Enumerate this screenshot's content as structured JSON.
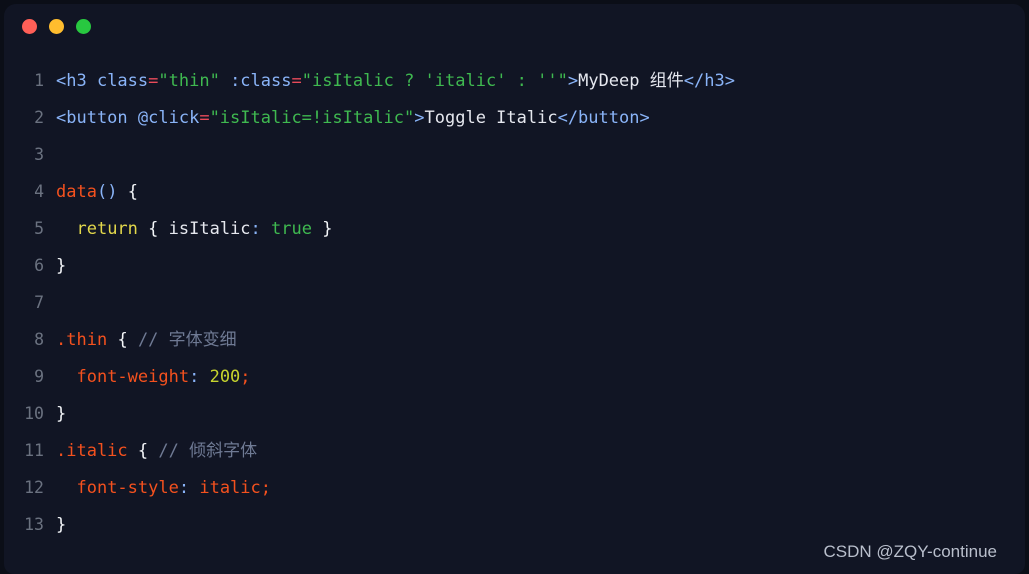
{
  "window": {
    "traffic_lights": [
      {
        "name": "close",
        "color": "#ff5f57"
      },
      {
        "name": "minimize",
        "color": "#ffbd2e"
      },
      {
        "name": "zoom",
        "color": "#28c840"
      }
    ],
    "background": "#111524",
    "page_background": "#0b0e17"
  },
  "editor": {
    "language": "vue",
    "line_numbers": [
      "1",
      "2",
      "3",
      "4",
      "5",
      "6",
      "7",
      "8",
      "9",
      "10",
      "11",
      "12",
      "13"
    ],
    "lines": [
      {
        "number": "1",
        "plain": "<h3 class=\"thin\" :class=\"isItalic ? 'italic' : ''\">MyDeep 组件</h3>",
        "tokens": [
          {
            "text": "<h3 ",
            "cls": "t-tag"
          },
          {
            "text": "class",
            "cls": "t-attr"
          },
          {
            "text": "=",
            "cls": "t-op"
          },
          {
            "text": "\"thin\"",
            "cls": "t-str"
          },
          {
            "text": " ",
            "cls": "t-text"
          },
          {
            "text": ":class",
            "cls": "t-attr"
          },
          {
            "text": "=",
            "cls": "t-op"
          },
          {
            "text": "\"isItalic ? 'italic' : ''\"",
            "cls": "t-str"
          },
          {
            "text": ">",
            "cls": "t-tag"
          },
          {
            "text": "MyDeep 组件",
            "cls": "t-text"
          },
          {
            "text": "</h3>",
            "cls": "t-tag"
          }
        ]
      },
      {
        "number": "2",
        "plain": "<button @click=\"isItalic=!isItalic\">Toggle Italic</button>",
        "tokens": [
          {
            "text": "<button ",
            "cls": "t-tag"
          },
          {
            "text": "@click",
            "cls": "t-attr"
          },
          {
            "text": "=",
            "cls": "t-op"
          },
          {
            "text": "\"isItalic=!isItalic\"",
            "cls": "t-str"
          },
          {
            "text": ">",
            "cls": "t-tag"
          },
          {
            "text": "Toggle Italic",
            "cls": "t-text"
          },
          {
            "text": "</button>",
            "cls": "t-tag"
          }
        ]
      },
      {
        "number": "3",
        "plain": "",
        "tokens": []
      },
      {
        "number": "4",
        "plain": "data() {",
        "tokens": [
          {
            "text": "data",
            "cls": "t-fn"
          },
          {
            "text": "()",
            "cls": "t-paren"
          },
          {
            "text": " ",
            "cls": "t-text"
          },
          {
            "text": "{",
            "cls": "t-brace"
          }
        ]
      },
      {
        "number": "5",
        "plain": "  return { isItalic: true }",
        "tokens": [
          {
            "text": "  ",
            "cls": "t-text"
          },
          {
            "text": "return",
            "cls": "t-kw"
          },
          {
            "text": " ",
            "cls": "t-text"
          },
          {
            "text": "{",
            "cls": "t-brace"
          },
          {
            "text": " isItalic",
            "cls": "t-prop"
          },
          {
            "text": ":",
            "cls": "t-colon"
          },
          {
            "text": " ",
            "cls": "t-text"
          },
          {
            "text": "true",
            "cls": "t-bool"
          },
          {
            "text": " ",
            "cls": "t-text"
          },
          {
            "text": "}",
            "cls": "t-brace"
          }
        ]
      },
      {
        "number": "6",
        "plain": "}",
        "tokens": [
          {
            "text": "}",
            "cls": "t-brace"
          }
        ]
      },
      {
        "number": "7",
        "plain": "",
        "tokens": []
      },
      {
        "number": "8",
        "plain": ".thin { // 字体变细",
        "tokens": [
          {
            "text": ".thin",
            "cls": "t-sel"
          },
          {
            "text": " ",
            "cls": "t-text"
          },
          {
            "text": "{",
            "cls": "t-brace"
          },
          {
            "text": " ",
            "cls": "t-text"
          },
          {
            "text": "// 字体变细",
            "cls": "t-comment"
          }
        ]
      },
      {
        "number": "9",
        "plain": "  font-weight: 200;",
        "tokens": [
          {
            "text": "  ",
            "cls": "t-text"
          },
          {
            "text": "font-weight",
            "cls": "t-cssprop"
          },
          {
            "text": ":",
            "cls": "t-colon"
          },
          {
            "text": " ",
            "cls": "t-text"
          },
          {
            "text": "200",
            "cls": "t-num"
          },
          {
            "text": ";",
            "cls": "t-punct"
          }
        ]
      },
      {
        "number": "10",
        "plain": "}",
        "tokens": [
          {
            "text": "}",
            "cls": "t-brace"
          }
        ]
      },
      {
        "number": "11",
        "plain": ".italic { // 倾斜字体",
        "tokens": [
          {
            "text": ".italic",
            "cls": "t-sel"
          },
          {
            "text": " ",
            "cls": "t-text"
          },
          {
            "text": "{",
            "cls": "t-brace"
          },
          {
            "text": " ",
            "cls": "t-text"
          },
          {
            "text": "// 倾斜字体",
            "cls": "t-comment"
          }
        ]
      },
      {
        "number": "12",
        "plain": "  font-style: italic;",
        "tokens": [
          {
            "text": "  ",
            "cls": "t-text"
          },
          {
            "text": "font-style",
            "cls": "t-cssprop"
          },
          {
            "text": ":",
            "cls": "t-colon"
          },
          {
            "text": " ",
            "cls": "t-text"
          },
          {
            "text": "italic",
            "cls": "t-cssval"
          },
          {
            "text": ";",
            "cls": "t-punct"
          }
        ]
      },
      {
        "number": "13",
        "plain": "}",
        "tokens": [
          {
            "text": "}",
            "cls": "t-brace"
          }
        ]
      }
    ]
  },
  "watermark": {
    "text": "CSDN @ZQY-continue"
  }
}
